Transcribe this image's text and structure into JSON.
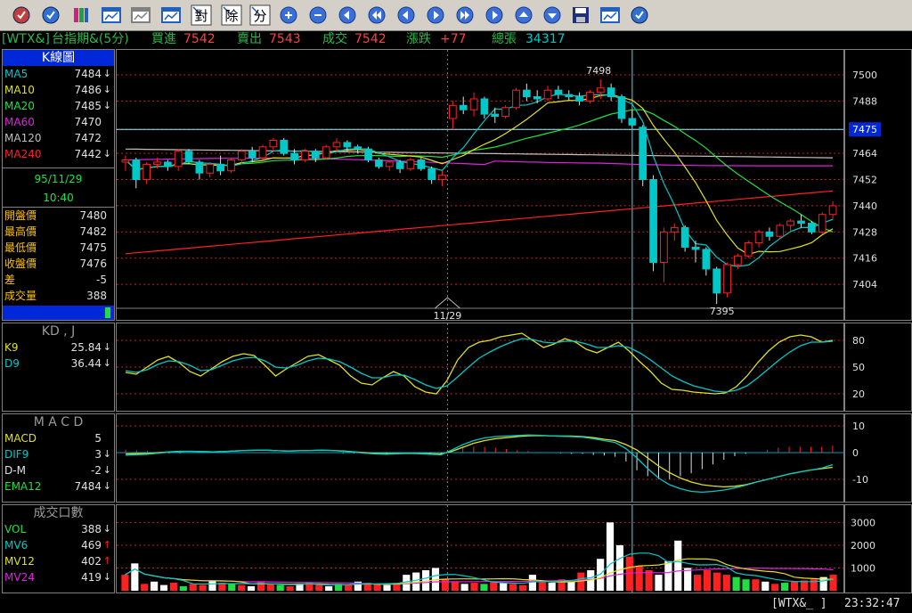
{
  "toolbar": {
    "buttons": [
      "lotus-icon",
      "refresh-icon",
      "books-icon",
      "chart-window-icon",
      "chart-window-gray-icon",
      "monitor-icon",
      "split-dui-icon",
      "split-chu-icon",
      "split-fen-icon",
      "zoom-in-icon",
      "zoom-out-icon",
      "scroll-left-icon",
      "fast-left-icon",
      "step-left-icon",
      "step-right-icon",
      "fast-right-icon",
      "scroll-right-icon",
      "scroll-up-icon",
      "scroll-down-icon",
      "save-icon",
      "print-icon",
      "help-icon"
    ],
    "dui_label": "對",
    "chu_label": "除",
    "fen_label": "分"
  },
  "quote": {
    "code": "[WTX&]",
    "name": "台指期&(5分)",
    "bid_label": "買進",
    "bid": "7542",
    "ask_label": "賣出",
    "ask": "7543",
    "trade_label": "成交",
    "trade": "7542",
    "change_label": "漲跌",
    "change": "+77",
    "volume_label": "總張",
    "volume": "34317"
  },
  "kline": {
    "title": "K線圖",
    "ma": [
      {
        "label": "MA5",
        "value": "7484",
        "arrow": "↓",
        "color": "#00c8c8",
        "arrow_color": "#e0e0e0"
      },
      {
        "label": "MA10",
        "value": "7486",
        "arrow": "↓",
        "color": "#e0e020",
        "arrow_color": "#e0e0e0"
      },
      {
        "label": "MA20",
        "value": "7485",
        "arrow": "↓",
        "color": "#20e040",
        "arrow_color": "#e0e0e0"
      },
      {
        "label": "MA60",
        "value": "7470",
        "arrow": "",
        "color": "#e020e0",
        "arrow_color": "#e0e0e0"
      },
      {
        "label": "MA120",
        "value": "7472",
        "arrow": "",
        "color": "#c0c0c0",
        "arrow_color": "#e0e0e0"
      },
      {
        "label": "MA240",
        "value": "7442",
        "arrow": "↓",
        "color": "#ff2020",
        "arrow_color": "#e0e0e0"
      }
    ],
    "date": "95/11/29",
    "time": "10:40",
    "ohlc": [
      {
        "label": "開盤價",
        "value": "7480"
      },
      {
        "label": "最高價",
        "value": "7482"
      },
      {
        "label": "最低價",
        "value": "7475"
      },
      {
        "label": "收盤價",
        "value": "7476"
      },
      {
        "label": "差",
        "value": "-5"
      },
      {
        "label": "成交量",
        "value": "388"
      }
    ],
    "axis_ticks": [
      "7500",
      "7488",
      "7475",
      "7464",
      "7452",
      "7440",
      "7428",
      "7416",
      "7404"
    ],
    "current_price_tag": "7475",
    "high_label": "7498",
    "low_label": "7395",
    "date_marker": "11/29"
  },
  "kd": {
    "title": "KD , J",
    "k": {
      "label": "K9",
      "value": "25.84",
      "arrow": "↓",
      "color": "#e0e020"
    },
    "d": {
      "label": "D9",
      "value": "36.44",
      "arrow": "↓",
      "color": "#00c8c8"
    },
    "axis_ticks": [
      "80",
      "50",
      "20"
    ]
  },
  "macd": {
    "title": "M A C D",
    "rows": [
      {
        "label": "MACD",
        "value": "5",
        "arrow": "",
        "color": "#e0e020"
      },
      {
        "label": "DIF9",
        "value": "3",
        "arrow": "↓",
        "color": "#00c8c8"
      },
      {
        "label": "D-M",
        "value": "-2",
        "arrow": "↓",
        "color": "#e0e0e0"
      },
      {
        "label": "EMA12",
        "value": "7484",
        "arrow": "↓",
        "color": "#20e040"
      }
    ],
    "axis_ticks": [
      "10",
      "0",
      "-10"
    ]
  },
  "vol": {
    "title": "成交口數",
    "rows": [
      {
        "label": "VOL",
        "value": "388",
        "arrow": "↓",
        "color": "#20e040"
      },
      {
        "label": "MV6",
        "value": "469",
        "arrow": "↑",
        "color": "#00c8c8"
      },
      {
        "label": "MV12",
        "value": "402",
        "arrow": "↑",
        "color": "#e0e020"
      },
      {
        "label": "MV24",
        "value": "419",
        "arrow": "↓",
        "color": "#e020e0"
      }
    ],
    "axis_ticks": [
      "3000",
      "2000",
      "1000"
    ]
  },
  "statusbar": {
    "symbol": "[WTX&_ ]",
    "clock": "23:32:47"
  },
  "colors": {
    "up": "#ff2020",
    "down": "#00c8c8",
    "grid_red": "#c02020",
    "grid_gray": "#606060"
  },
  "chart_data": [
    {
      "type": "candlestick",
      "title": "K線圖",
      "ylim": [
        7393,
        7509
      ],
      "date_marker": "11/29",
      "candles": [
        {
          "o": 7460,
          "h": 7463,
          "l": 7456,
          "c": 7461
        },
        {
          "o": 7461,
          "h": 7462,
          "l": 7448,
          "c": 7452
        },
        {
          "o": 7452,
          "h": 7460,
          "l": 7450,
          "c": 7459
        },
        {
          "o": 7459,
          "h": 7462,
          "l": 7457,
          "c": 7460
        },
        {
          "o": 7460,
          "h": 7461,
          "l": 7456,
          "c": 7458
        },
        {
          "o": 7458,
          "h": 7466,
          "l": 7456,
          "c": 7465
        },
        {
          "o": 7465,
          "h": 7466,
          "l": 7459,
          "c": 7460
        },
        {
          "o": 7460,
          "h": 7461,
          "l": 7452,
          "c": 7455
        },
        {
          "o": 7455,
          "h": 7460,
          "l": 7453,
          "c": 7459
        },
        {
          "o": 7459,
          "h": 7463,
          "l": 7454,
          "c": 7456
        },
        {
          "o": 7456,
          "h": 7462,
          "l": 7455,
          "c": 7461
        },
        {
          "o": 7461,
          "h": 7466,
          "l": 7459,
          "c": 7465
        },
        {
          "o": 7465,
          "h": 7467,
          "l": 7460,
          "c": 7462
        },
        {
          "o": 7462,
          "h": 7468,
          "l": 7461,
          "c": 7467
        },
        {
          "o": 7467,
          "h": 7471,
          "l": 7465,
          "c": 7470
        },
        {
          "o": 7470,
          "h": 7471,
          "l": 7463,
          "c": 7464
        },
        {
          "o": 7464,
          "h": 7466,
          "l": 7459,
          "c": 7461
        },
        {
          "o": 7461,
          "h": 7466,
          "l": 7460,
          "c": 7465
        },
        {
          "o": 7465,
          "h": 7466,
          "l": 7460,
          "c": 7462
        },
        {
          "o": 7462,
          "h": 7468,
          "l": 7461,
          "c": 7467
        },
        {
          "o": 7467,
          "h": 7471,
          "l": 7465,
          "c": 7469
        },
        {
          "o": 7469,
          "h": 7470,
          "l": 7465,
          "c": 7467
        },
        {
          "o": 7467,
          "h": 7468,
          "l": 7464,
          "c": 7466
        },
        {
          "o": 7466,
          "h": 7467,
          "l": 7460,
          "c": 7461
        },
        {
          "o": 7461,
          "h": 7462,
          "l": 7457,
          "c": 7458
        },
        {
          "o": 7458,
          "h": 7461,
          "l": 7456,
          "c": 7460
        },
        {
          "o": 7460,
          "h": 7461,
          "l": 7455,
          "c": 7457
        },
        {
          "o": 7457,
          "h": 7462,
          "l": 7456,
          "c": 7461
        },
        {
          "o": 7461,
          "h": 7462,
          "l": 7456,
          "c": 7457
        },
        {
          "o": 7457,
          "h": 7458,
          "l": 7450,
          "c": 7452
        },
        {
          "o": 7452,
          "h": 7456,
          "l": 7449,
          "c": 7454
        },
        {
          "o": 7480,
          "h": 7488,
          "l": 7475,
          "c": 7486
        },
        {
          "o": 7486,
          "h": 7490,
          "l": 7482,
          "c": 7484
        },
        {
          "o": 7484,
          "h": 7492,
          "l": 7481,
          "c": 7489
        },
        {
          "o": 7489,
          "h": 7490,
          "l": 7480,
          "c": 7482
        },
        {
          "o": 7482,
          "h": 7485,
          "l": 7478,
          "c": 7481
        },
        {
          "o": 7481,
          "h": 7486,
          "l": 7480,
          "c": 7485
        },
        {
          "o": 7485,
          "h": 7494,
          "l": 7484,
          "c": 7493
        },
        {
          "o": 7493,
          "h": 7496,
          "l": 7488,
          "c": 7490
        },
        {
          "o": 7490,
          "h": 7493,
          "l": 7487,
          "c": 7489
        },
        {
          "o": 7489,
          "h": 7495,
          "l": 7488,
          "c": 7493
        },
        {
          "o": 7493,
          "h": 7495,
          "l": 7489,
          "c": 7491
        },
        {
          "o": 7491,
          "h": 7493,
          "l": 7488,
          "c": 7490
        },
        {
          "o": 7490,
          "h": 7492,
          "l": 7486,
          "c": 7488
        },
        {
          "o": 7488,
          "h": 7493,
          "l": 7487,
          "c": 7492
        },
        {
          "o": 7492,
          "h": 7498,
          "l": 7489,
          "c": 7494
        },
        {
          "o": 7494,
          "h": 7496,
          "l": 7488,
          "c": 7490
        },
        {
          "o": 7490,
          "h": 7491,
          "l": 7478,
          "c": 7480
        },
        {
          "o": 7480,
          "h": 7484,
          "l": 7476,
          "c": 7477
        },
        {
          "o": 7476,
          "h": 7477,
          "l": 7449,
          "c": 7452
        },
        {
          "o": 7452,
          "h": 7454,
          "l": 7410,
          "c": 7414
        },
        {
          "o": 7414,
          "h": 7430,
          "l": 7405,
          "c": 7428
        },
        {
          "o": 7428,
          "h": 7432,
          "l": 7424,
          "c": 7430
        },
        {
          "o": 7430,
          "h": 7431,
          "l": 7419,
          "c": 7421
        },
        {
          "o": 7421,
          "h": 7424,
          "l": 7414,
          "c": 7420
        },
        {
          "o": 7420,
          "h": 7421,
          "l": 7408,
          "c": 7411
        },
        {
          "o": 7411,
          "h": 7412,
          "l": 7395,
          "c": 7400
        },
        {
          "o": 7400,
          "h": 7414,
          "l": 7398,
          "c": 7413
        },
        {
          "o": 7413,
          "h": 7418,
          "l": 7411,
          "c": 7417
        },
        {
          "o": 7417,
          "h": 7424,
          "l": 7416,
          "c": 7423
        },
        {
          "o": 7423,
          "h": 7429,
          "l": 7421,
          "c": 7428
        },
        {
          "o": 7428,
          "h": 7430,
          "l": 7424,
          "c": 7426
        },
        {
          "o": 7426,
          "h": 7432,
          "l": 7425,
          "c": 7431
        },
        {
          "o": 7431,
          "h": 7434,
          "l": 7428,
          "c": 7433
        },
        {
          "o": 7433,
          "h": 7436,
          "l": 7430,
          "c": 7432
        },
        {
          "o": 7432,
          "h": 7433,
          "l": 7427,
          "c": 7428
        },
        {
          "o": 7428,
          "h": 7437,
          "l": 7427,
          "c": 7436
        },
        {
          "o": 7436,
          "h": 7442,
          "l": 7434,
          "c": 7440
        }
      ]
    },
    {
      "type": "line",
      "title": "KD , J",
      "ylim": [
        5,
        95
      ],
      "series": [
        {
          "name": "K9",
          "values": [
            44,
            42,
            50,
            58,
            62,
            55,
            45,
            40,
            48,
            56,
            62,
            65,
            63,
            52,
            40,
            48,
            55,
            62,
            64,
            58,
            52,
            40,
            32,
            30,
            38,
            45,
            40,
            28,
            22,
            20,
            35,
            58,
            72,
            78,
            80,
            84,
            86,
            88,
            80,
            72,
            76,
            82,
            78,
            70,
            66,
            72,
            78,
            68,
            56,
            45,
            32,
            25,
            24,
            22,
            21,
            20,
            21,
            28,
            40,
            55,
            68,
            78,
            84,
            86,
            84,
            78,
            80
          ]
        },
        {
          "name": "D9",
          "values": [
            46,
            44,
            47,
            53,
            57,
            56,
            52,
            46,
            47,
            52,
            57,
            60,
            61,
            57,
            50,
            49,
            52,
            57,
            60,
            59,
            56,
            50,
            43,
            38,
            38,
            41,
            41,
            36,
            30,
            26,
            29,
            39,
            50,
            60,
            67,
            73,
            78,
            82,
            81,
            78,
            77,
            79,
            79,
            76,
            72,
            72,
            74,
            72,
            66,
            58,
            49,
            40,
            34,
            29,
            26,
            23,
            22,
            24,
            29,
            38,
            48,
            58,
            67,
            74,
            78,
            78,
            79
          ]
        }
      ]
    },
    {
      "type": "line",
      "title": "M A C D",
      "ylim": [
        -17,
        13
      ],
      "series": [
        {
          "name": "MACD",
          "values": [
            -0.5,
            -0.4,
            -0.3,
            0,
            0.3,
            0.5,
            0.5,
            0.4,
            0.3,
            0.4,
            0.6,
            0.8,
            0.9,
            0.9,
            0.7,
            0.6,
            0.7,
            0.8,
            0.9,
            0.8,
            0.6,
            0.3,
            0,
            -0.3,
            -0.4,
            -0.3,
            -0.2,
            -0.3,
            -0.4,
            -0.5,
            0.5,
            2,
            3.5,
            4.5,
            5.2,
            5.6,
            6,
            6.3,
            6.4,
            6.3,
            6.2,
            6.2,
            6,
            5.6,
            5,
            4.5,
            3,
            1,
            -2,
            -5,
            -7.5,
            -9.5,
            -11,
            -12,
            -12.5,
            -12.8,
            -12.6,
            -12,
            -11,
            -10,
            -9,
            -8,
            -7.2,
            -6.5,
            -6,
            -5.5
          ]
        },
        {
          "name": "DIF9",
          "values": [
            -1,
            -0.8,
            -0.6,
            -0.2,
            0.2,
            0.4,
            0.5,
            0.4,
            0.3,
            0.4,
            0.6,
            0.8,
            0.9,
            0.9,
            0.7,
            0.6,
            0.7,
            0.8,
            0.9,
            0.8,
            0.5,
            0.2,
            -0.2,
            -0.5,
            -0.6,
            -0.4,
            -0.3,
            -0.4,
            -0.6,
            -0.8,
            1,
            3,
            4.5,
            5.5,
            6,
            6.2,
            6.4,
            6.6,
            6.5,
            6.3,
            6.1,
            6,
            5.8,
            5.2,
            4.5,
            3.8,
            1.5,
            -2,
            -6,
            -9.5,
            -12,
            -13.5,
            -14.5,
            -14.8,
            -14.5,
            -14,
            -13.2,
            -12.2,
            -11,
            -10,
            -9,
            -8,
            -7.2,
            -6.5,
            -5.8,
            -4.5
          ]
        }
      ],
      "hist": [
        0.5,
        0.4,
        0.3,
        -0.2,
        -0.1,
        -0.1,
        0,
        0,
        0,
        0,
        0,
        0,
        0,
        0,
        0,
        0,
        0,
        0,
        0,
        0,
        -0.1,
        -0.1,
        -0.2,
        -0.2,
        -0.2,
        -0.1,
        -0.1,
        -0.1,
        -0.2,
        -0.3,
        0.5,
        1,
        1,
        1,
        0.8,
        0.6,
        0.4,
        0.3,
        0.1,
        0,
        -0.1,
        -0.2,
        -0.2,
        -0.4,
        -0.5,
        -0.7,
        -1.5,
        -3,
        -4,
        -4.5,
        -4.5,
        -4,
        -3.5,
        -2.8,
        -2,
        -1.2,
        -0.6,
        -0.2,
        0,
        0.5,
        0.8,
        1,
        1,
        1,
        1,
        1.2
      ]
    },
    {
      "type": "bar",
      "title": "成交口數",
      "ylim": [
        0,
        3600
      ],
      "values": [
        700,
        1200,
        300,
        400,
        250,
        350,
        200,
        300,
        250,
        450,
        350,
        300,
        250,
        200,
        400,
        300,
        250,
        200,
        300,
        350,
        250,
        200,
        300,
        250,
        400,
        350,
        300,
        250,
        350,
        700,
        800,
        900,
        1000,
        500,
        400,
        300,
        350,
        300,
        400,
        350,
        300,
        250,
        700,
        450,
        350,
        500,
        400,
        800,
        900,
        1400,
        3000,
        2000,
        1500,
        1100,
        900,
        700,
        1300,
        2200,
        1000,
        700,
        900,
        800,
        700,
        600,
        500,
        500,
        400,
        300,
        350,
        400,
        450,
        500,
        600,
        700
      ],
      "colors": [
        "r",
        "w",
        "r",
        "w",
        "w",
        "r",
        "g",
        "r",
        "r",
        "w",
        "r",
        "g",
        "r",
        "w",
        "r",
        "r",
        "g",
        "r",
        "w",
        "r",
        "r",
        "w",
        "g",
        "r",
        "w",
        "r",
        "r",
        "w",
        "r",
        "w",
        "w",
        "w",
        "w",
        "r",
        "r",
        "w",
        "r",
        "g",
        "r",
        "w",
        "r",
        "r",
        "w",
        "r",
        "w",
        "r",
        "w",
        "r",
        "w",
        "w",
        "w",
        "w",
        "r",
        "r",
        "r",
        "w",
        "w",
        "w",
        "w",
        "r",
        "r",
        "r",
        "r",
        "g",
        "g",
        "r",
        "w",
        "r",
        "g",
        "r",
        "r",
        "r",
        "w",
        "r"
      ]
    }
  ]
}
